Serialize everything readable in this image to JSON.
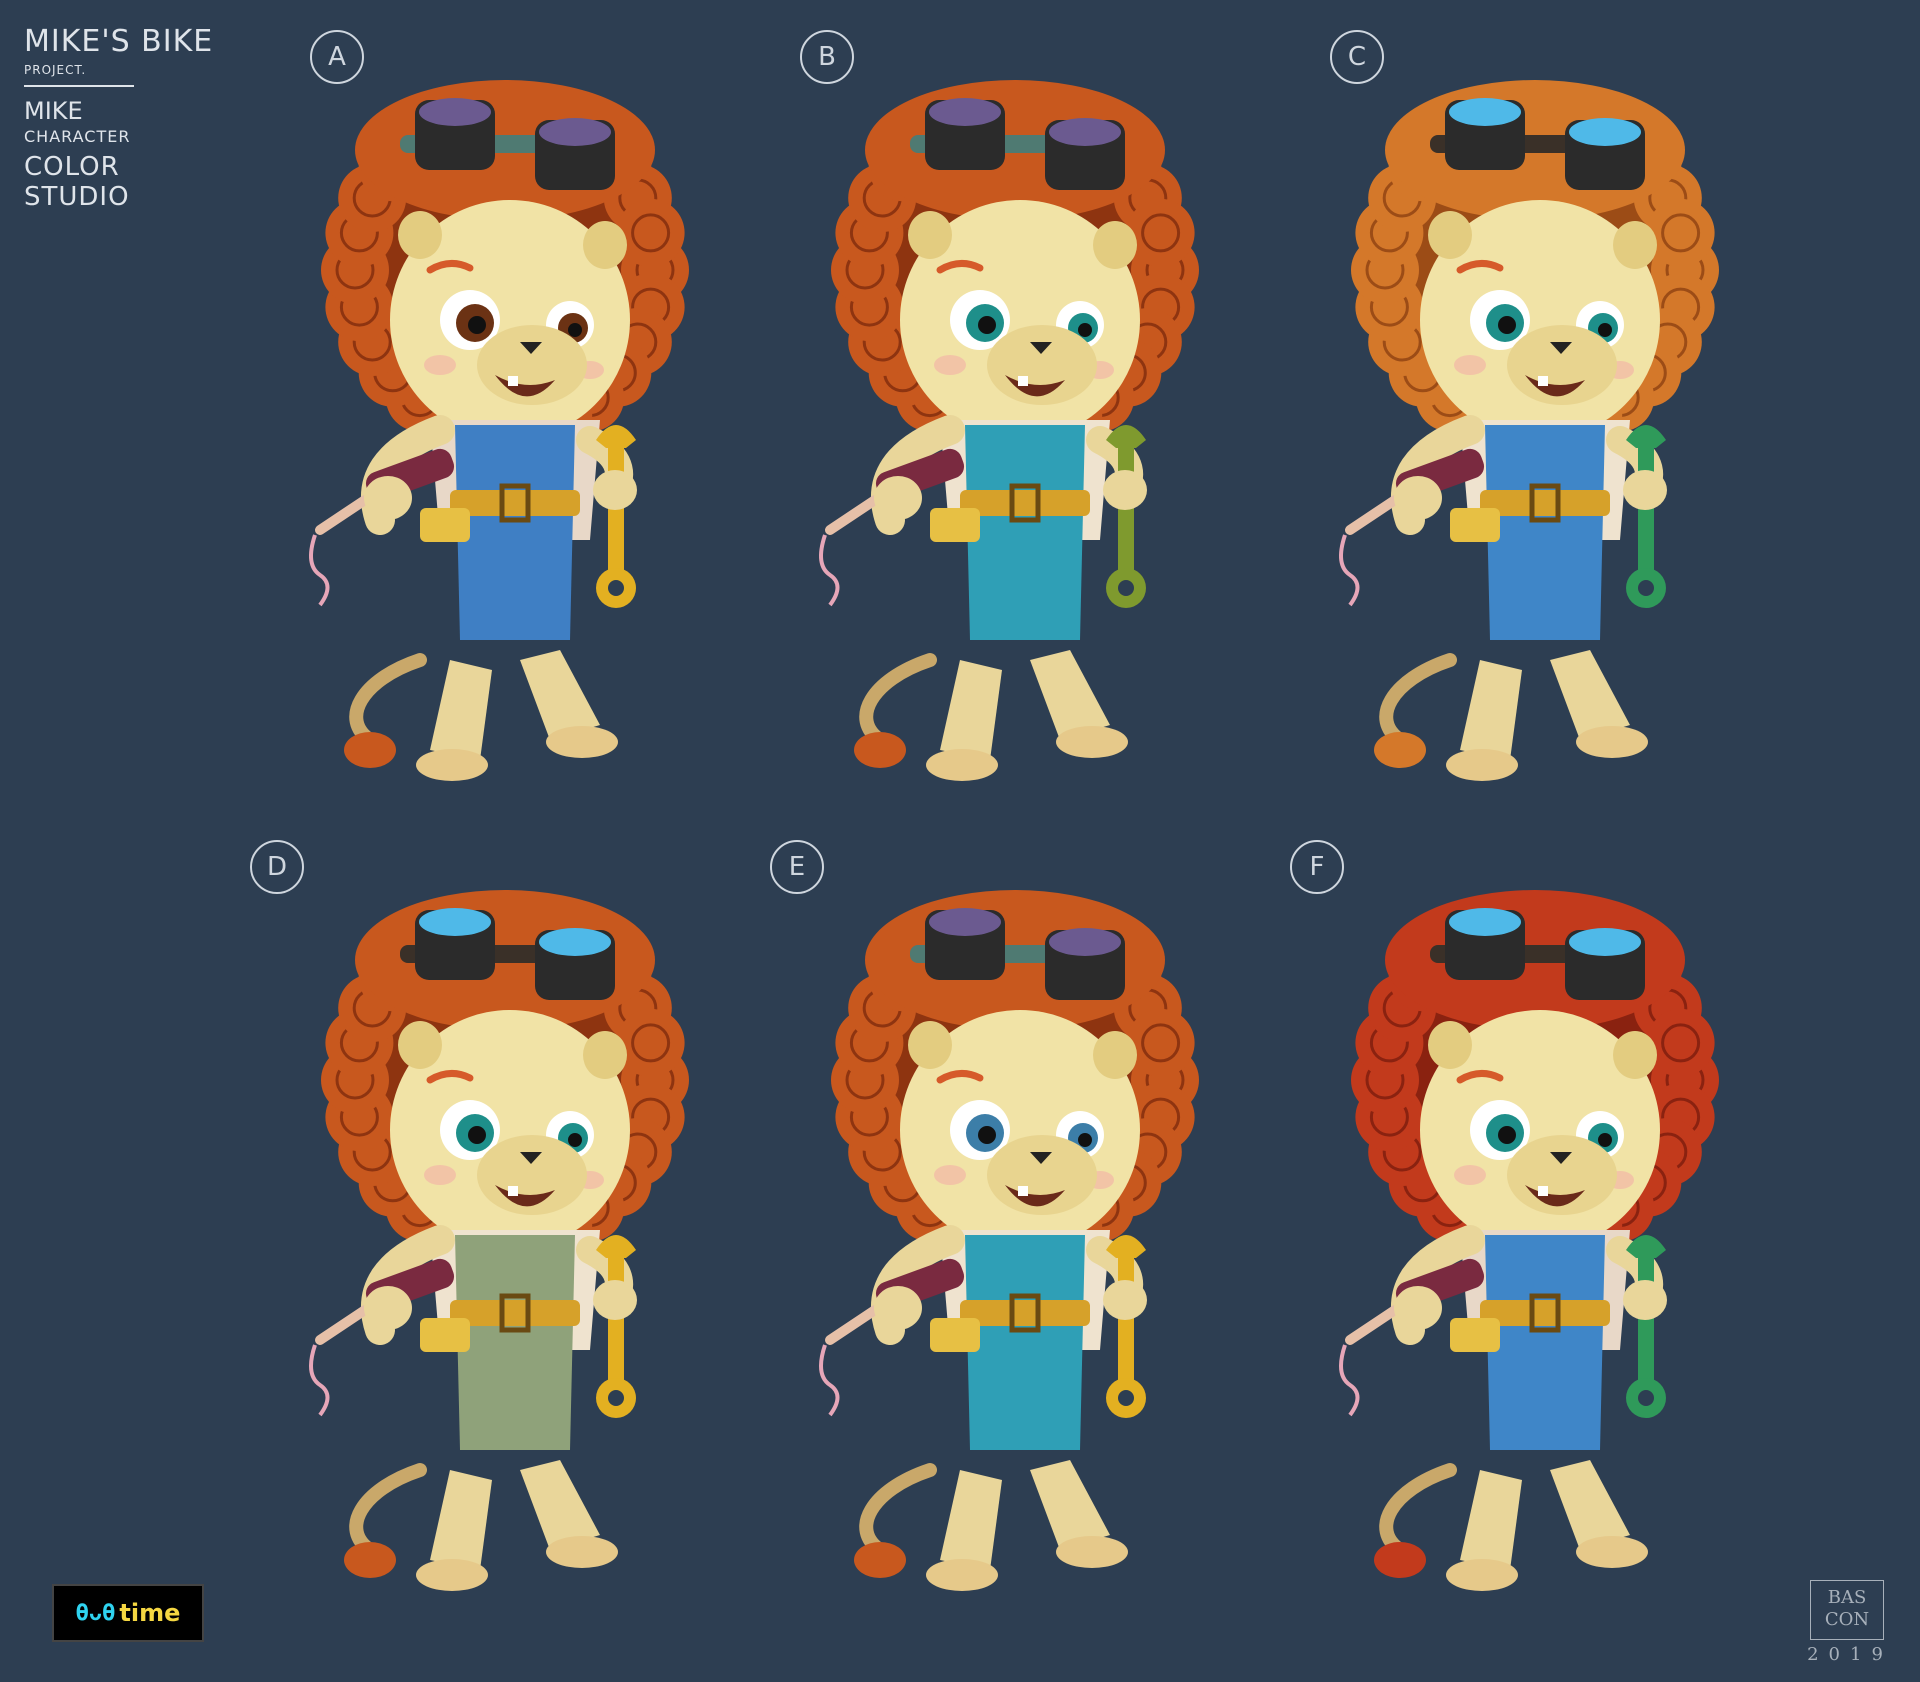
{
  "title": {
    "project_line1": "MIKE'S BIKE",
    "project_line2": "PROJECT.",
    "character_name": "MIKE",
    "character_label": "CHARACTER",
    "studio_label": "COLOR STUDIO"
  },
  "variants": [
    {
      "letter": "A",
      "hair": "#c8581e",
      "hair_dark": "#8e3410",
      "eyes": "#6b3214",
      "overalls": "#3f7fc4",
      "shirt": "#e8d8c8",
      "wrench": "#e3b021",
      "goggle_lens": "#6b5a90",
      "goggle_rim": "#4f7a72"
    },
    {
      "letter": "B",
      "hair": "#c8581e",
      "hair_dark": "#8e3410",
      "eyes": "#1e8f8a",
      "overalls": "#2f9fb6",
      "shirt": "#efe3cf",
      "wrench": "#7f9a2e",
      "goggle_lens": "#6b5a90",
      "goggle_rim": "#4f7a72"
    },
    {
      "letter": "C",
      "hair": "#d4782a",
      "hair_dark": "#9c4c16",
      "eyes": "#1e8f8a",
      "overalls": "#3f86c8",
      "shirt": "#efe3cf",
      "wrench": "#2f9a5a",
      "goggle_lens": "#4fb9e8",
      "goggle_rim": "#3a3028"
    },
    {
      "letter": "D",
      "hair": "#c8581e",
      "hair_dark": "#8e3410",
      "eyes": "#1e8f8a",
      "overalls": "#8fa27a",
      "shirt": "#efe3cf",
      "wrench": "#e3b021",
      "goggle_lens": "#4fb9e8",
      "goggle_rim": "#3a3028"
    },
    {
      "letter": "E",
      "hair": "#c8581e",
      "hair_dark": "#8e3410",
      "eyes": "#3c7ea8",
      "overalls": "#2f9fb6",
      "shirt": "#efe3cf",
      "wrench": "#e3b021",
      "goggle_lens": "#6b5a90",
      "goggle_rim": "#4f7a72"
    },
    {
      "letter": "F",
      "hair": "#c23a1c",
      "hair_dark": "#8a2210",
      "eyes": "#1e8f8a",
      "overalls": "#3f86c8",
      "shirt": "#e8d8c8",
      "wrench": "#2f9a5a",
      "goggle_lens": "#4fb9e8",
      "goggle_rim": "#3a3028"
    }
  ],
  "logo": {
    "mark": "ϴᴗϴ",
    "text": "time"
  },
  "signature": {
    "initials": "BAS CON",
    "year": "2019"
  }
}
